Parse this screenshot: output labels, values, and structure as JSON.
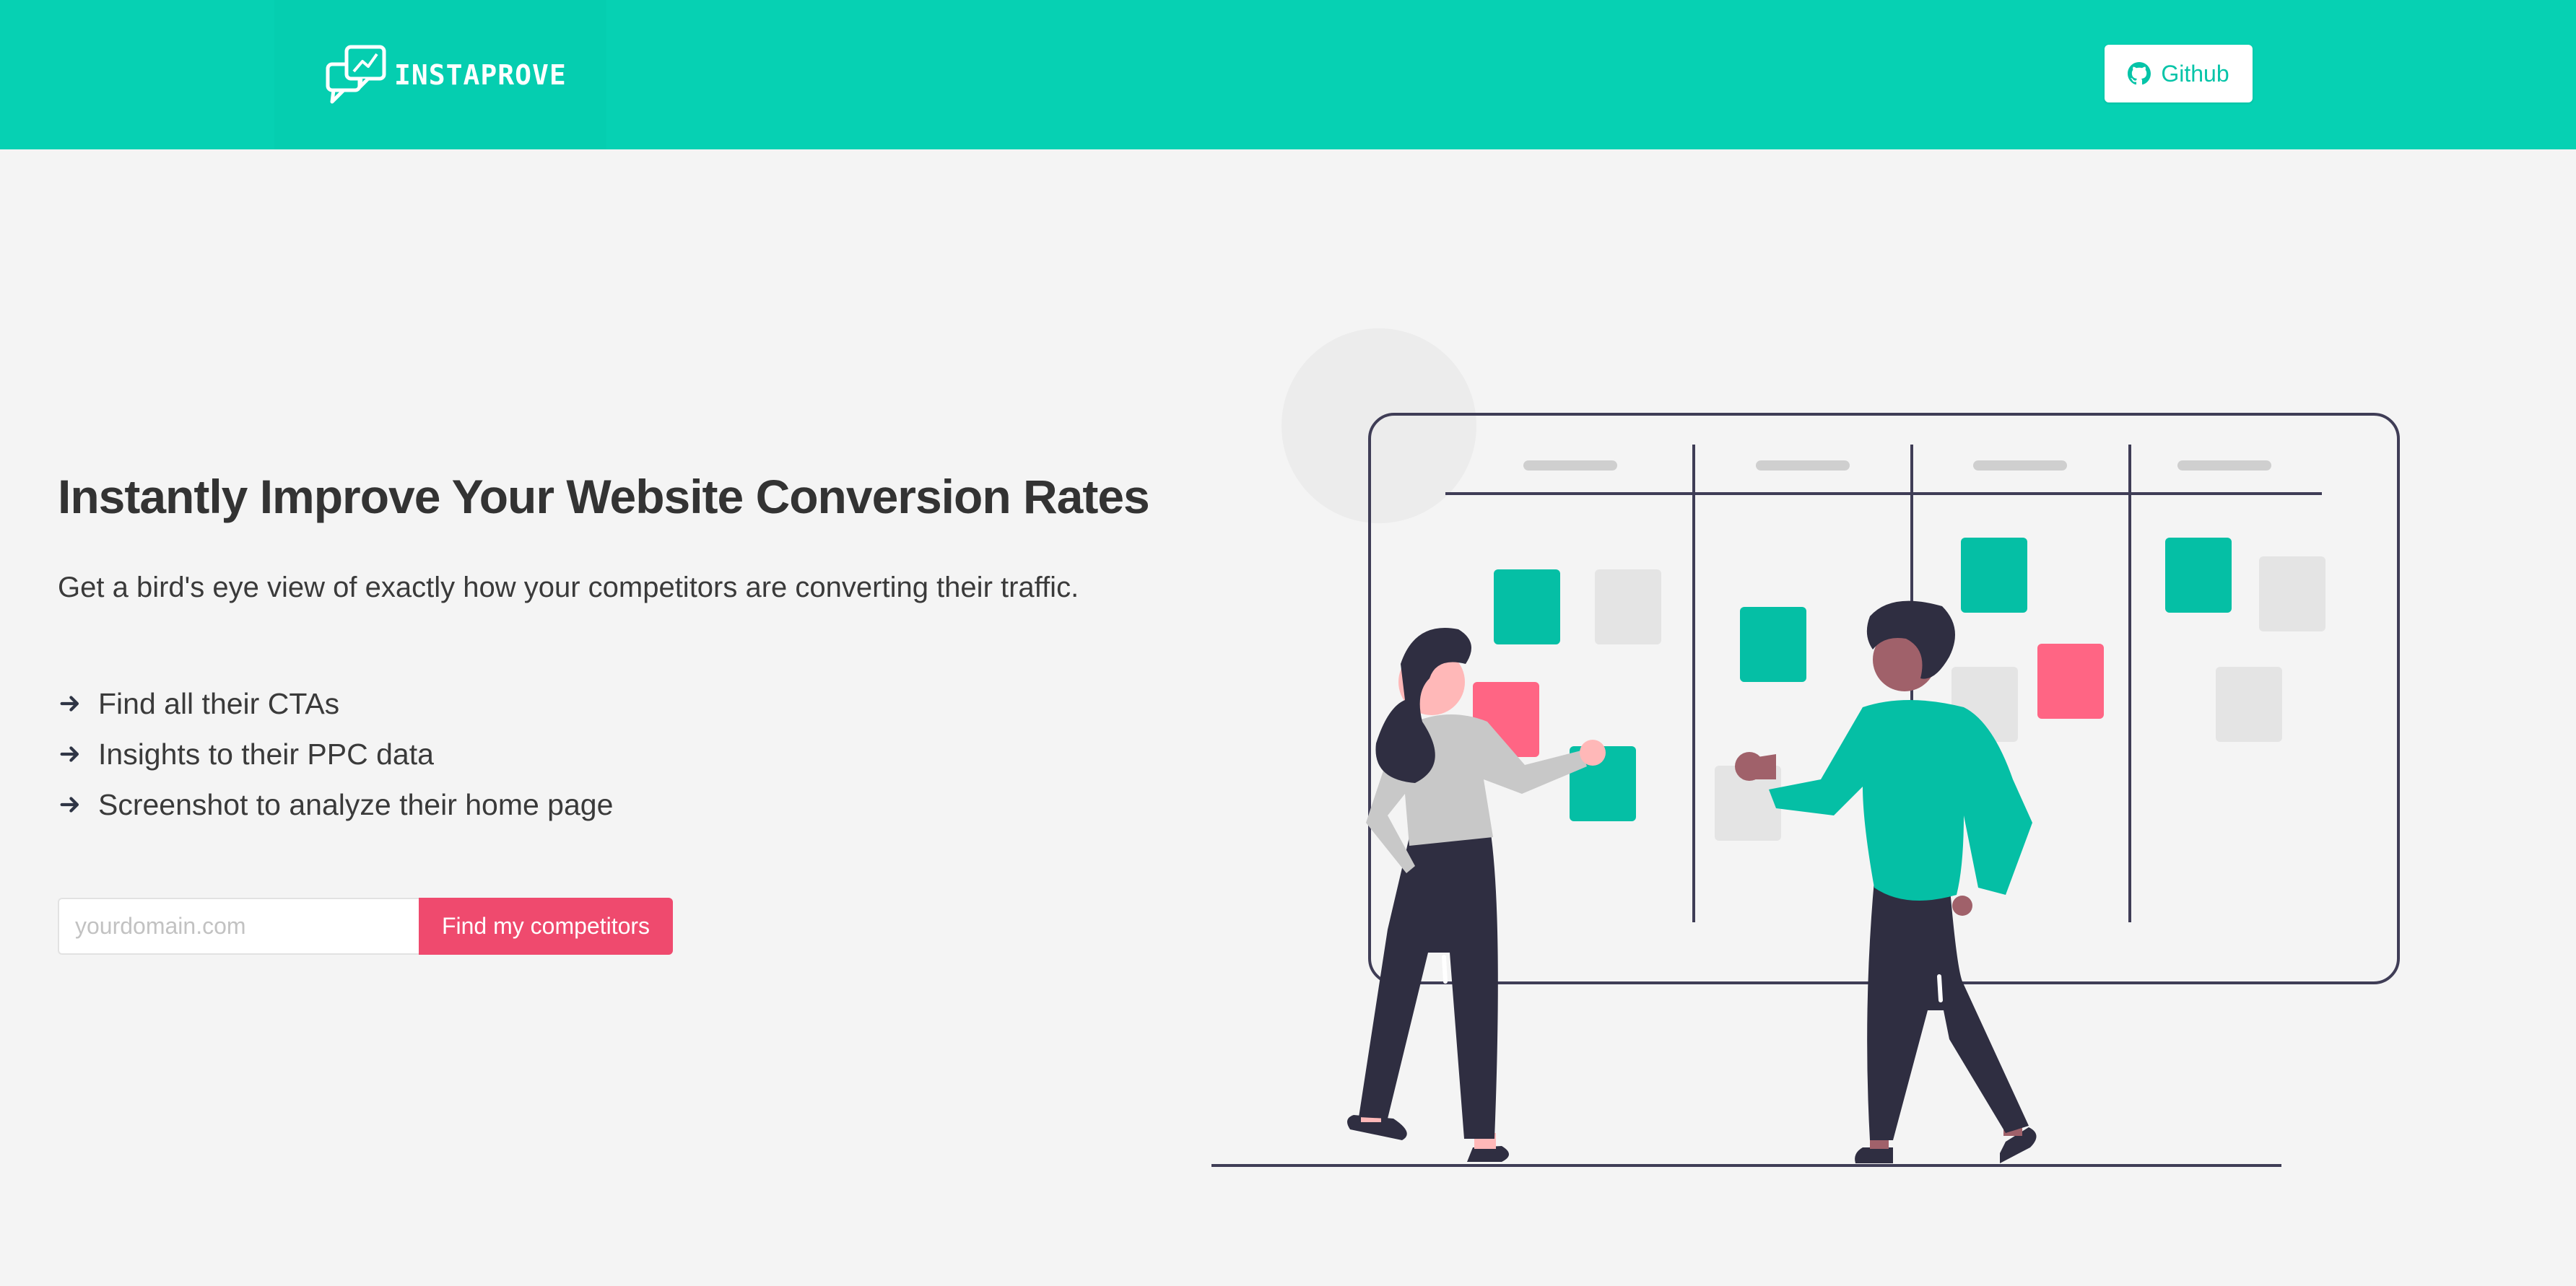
{
  "header": {
    "logo_text": "INSTAPROVE",
    "logo_icon": "chat-bubbles-chart-icon",
    "github_label": "Github",
    "github_icon": "github-icon"
  },
  "hero": {
    "title": "Instantly Improve Your Website Conversion Rates",
    "subtitle": "Get a bird's eye view of exactly how your competitors are converting their traffic.",
    "features": [
      {
        "icon": "arrow-right-icon",
        "label": "Find all their CTAs"
      },
      {
        "icon": "arrow-right-icon",
        "label": "Insights to their PPC data"
      },
      {
        "icon": "arrow-right-icon",
        "label": "Screenshot to analyze their home page"
      }
    ]
  },
  "form": {
    "domain_placeholder": "yourdomain.com",
    "domain_value": "",
    "submit_label": "Find my competitors"
  },
  "colors": {
    "brand": "#06d1b3",
    "accent": "#ef4a6e",
    "board_teal": "#05bfa5",
    "board_pink": "#ff6584",
    "ink": "#2f2e41"
  }
}
